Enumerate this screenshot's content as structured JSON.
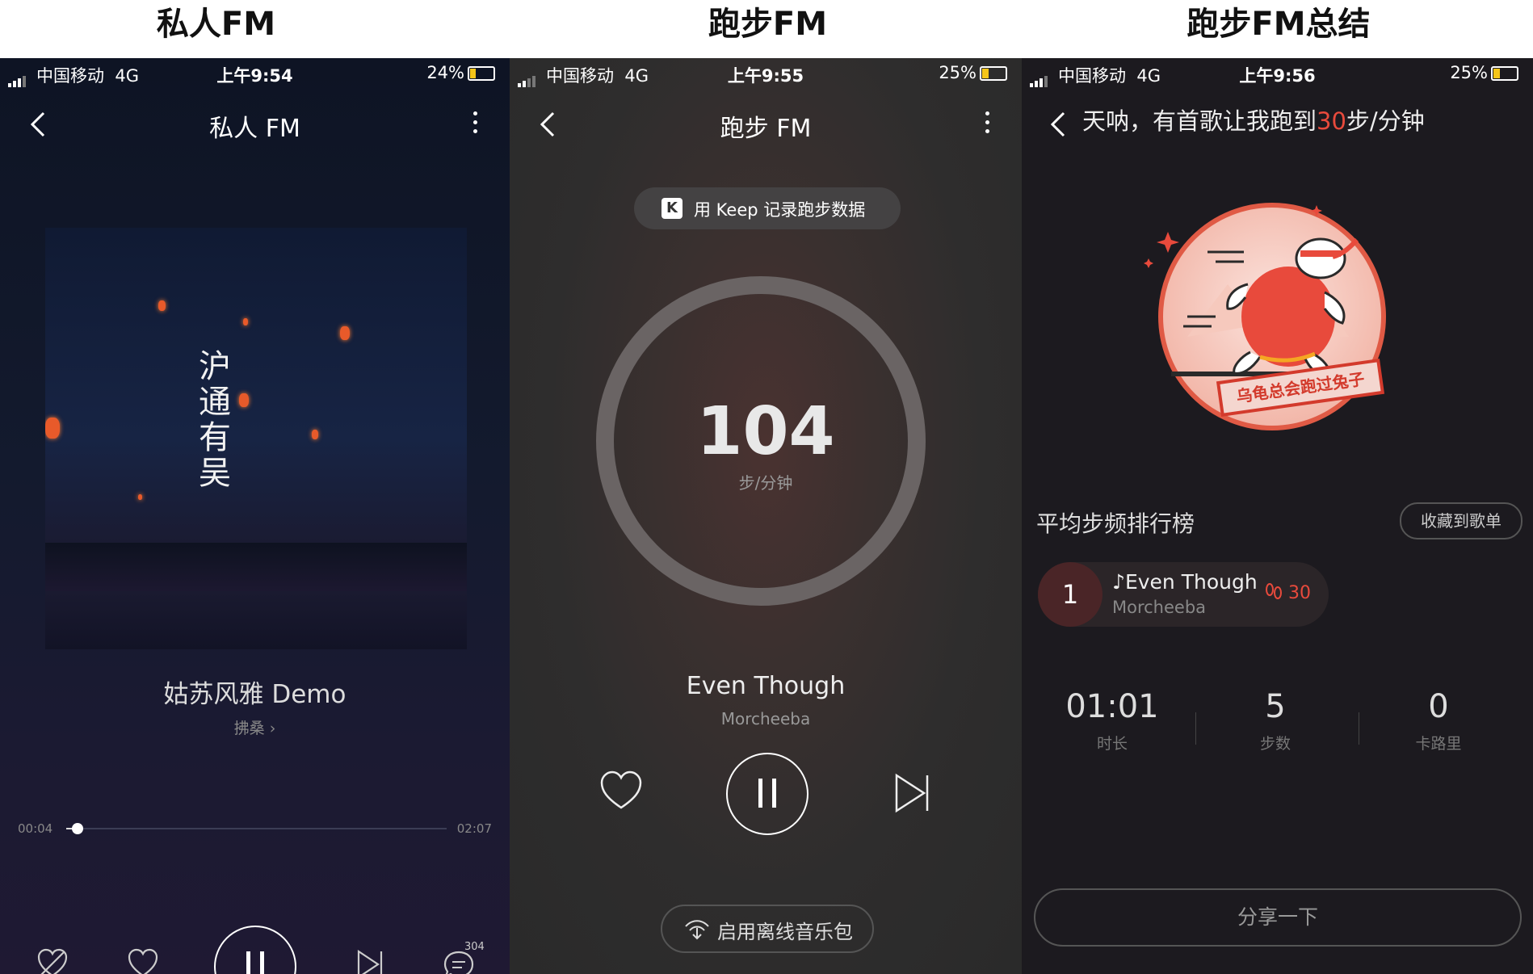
{
  "captions": [
    "私人FM",
    "跑步FM",
    "跑步FM总结"
  ],
  "colors": {
    "accent_red": "#e84a3c",
    "battery": "#f5c518"
  },
  "panel1": {
    "status": {
      "carrier": "中国移动",
      "network": "4G",
      "time": "上午9:54",
      "battery": "24%"
    },
    "title": "私人 FM",
    "cover_text": "沪通有吴",
    "song": "姑苏风雅 Demo",
    "artist": "拂桑 ›",
    "time_current": "00:04",
    "time_total": "02:07",
    "progress": 0.03,
    "comment_count": "304",
    "icons": [
      "chevron-left-icon",
      "more-icon",
      "dislike-icon",
      "heart-icon",
      "pause-icon",
      "next-icon",
      "comment-icon"
    ]
  },
  "panel2": {
    "status": {
      "carrier": "中国移动",
      "network": "4G",
      "time": "上午9:55",
      "battery": "25%"
    },
    "title": "跑步 FM",
    "keep_button": "用 Keep 记录跑步数据",
    "keep_logo": "K",
    "cadence": "104",
    "cadence_unit": "步/分钟",
    "song": "Even Though",
    "artist": "Morcheeba",
    "offline_button": "启用离线音乐包"
  },
  "panel3": {
    "status": {
      "carrier": "中国移动",
      "network": "4G",
      "time": "上午9:56",
      "battery": "25%"
    },
    "headline_prefix": "天呐，有首歌让我跑到",
    "headline_value": "30",
    "headline_suffix": "步/分钟",
    "stamp_text": "乌龟总会跑过兔子",
    "section_title": "平均步频排行榜",
    "collect_button": "收藏到歌单",
    "ranking": [
      {
        "rank": "1",
        "song": "♪Even Though",
        "artist": "Morcheeba",
        "value": "30"
      }
    ],
    "stats": [
      {
        "value": "01:01",
        "label": "时长"
      },
      {
        "value": "5",
        "label": "步数"
      },
      {
        "value": "0",
        "label": "卡路里"
      }
    ],
    "share_button": "分享一下"
  }
}
